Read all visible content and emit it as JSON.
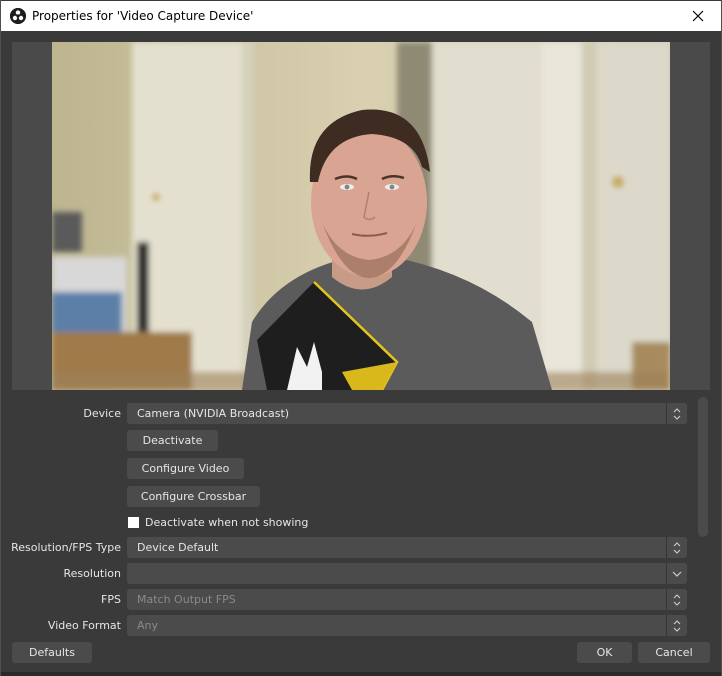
{
  "window": {
    "title": "Properties for 'Video Capture Device'",
    "app_icon": "obs-logo-icon",
    "close_icon": "close-icon"
  },
  "preview": {
    "description": "Webcam preview showing person in grey t-shirt in front of doors"
  },
  "properties": {
    "device": {
      "label": "Device",
      "value": "Camera (NVIDIA Broadcast)"
    },
    "buttons": {
      "deactivate": "Deactivate",
      "configure_video": "Configure Video",
      "configure_crossbar": "Configure Crossbar"
    },
    "deactivate_when_not_showing": {
      "label": "Deactivate when not showing",
      "checked": false
    },
    "resolution_fps_type": {
      "label": "Resolution/FPS Type",
      "value": "Device Default"
    },
    "resolution": {
      "label": "Resolution",
      "value": ""
    },
    "fps": {
      "label": "FPS",
      "value": "Match Output FPS"
    },
    "video_format": {
      "label": "Video Format",
      "value": "Any"
    }
  },
  "footer": {
    "defaults": "Defaults",
    "ok": "OK",
    "cancel": "Cancel"
  },
  "colors": {
    "background": "#3a3a3a",
    "control": "#4b4b4b",
    "text": "#e6e6e6",
    "disabled_text": "#8a8a8a"
  }
}
